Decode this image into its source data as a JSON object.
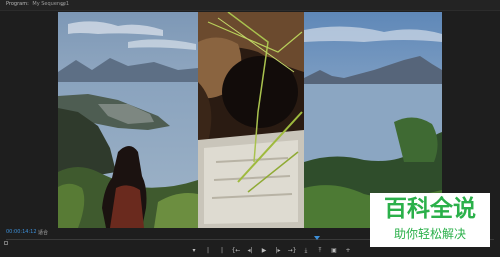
{
  "app": {
    "panel_title": "Program:",
    "sequence_name": "My Sequence1",
    "panel_menu": "≡"
  },
  "monitor": {
    "timecode": "00:00:14:12",
    "fit_label": "适合"
  },
  "controls": {
    "icons": [
      "mark-in-icon",
      "mark-out-icon",
      "go-to-in-icon",
      "step-back-icon",
      "play-icon",
      "step-forward-icon",
      "go-to-out-icon",
      "insert-icon",
      "overwrite-icon",
      "export-frame-icon",
      "add-icon"
    ],
    "glyphs": [
      "▾",
      "|",
      "|",
      "{←",
      "◂|",
      "▶",
      "|▸",
      "→}",
      "⤓",
      "⤒",
      "▣",
      "+"
    ]
  },
  "colors": {
    "accent": "#3d8fd8",
    "watermark_green": "#2bb04a"
  },
  "watermark": {
    "title": "百科全说",
    "subtitle": "助你轻松解决"
  }
}
